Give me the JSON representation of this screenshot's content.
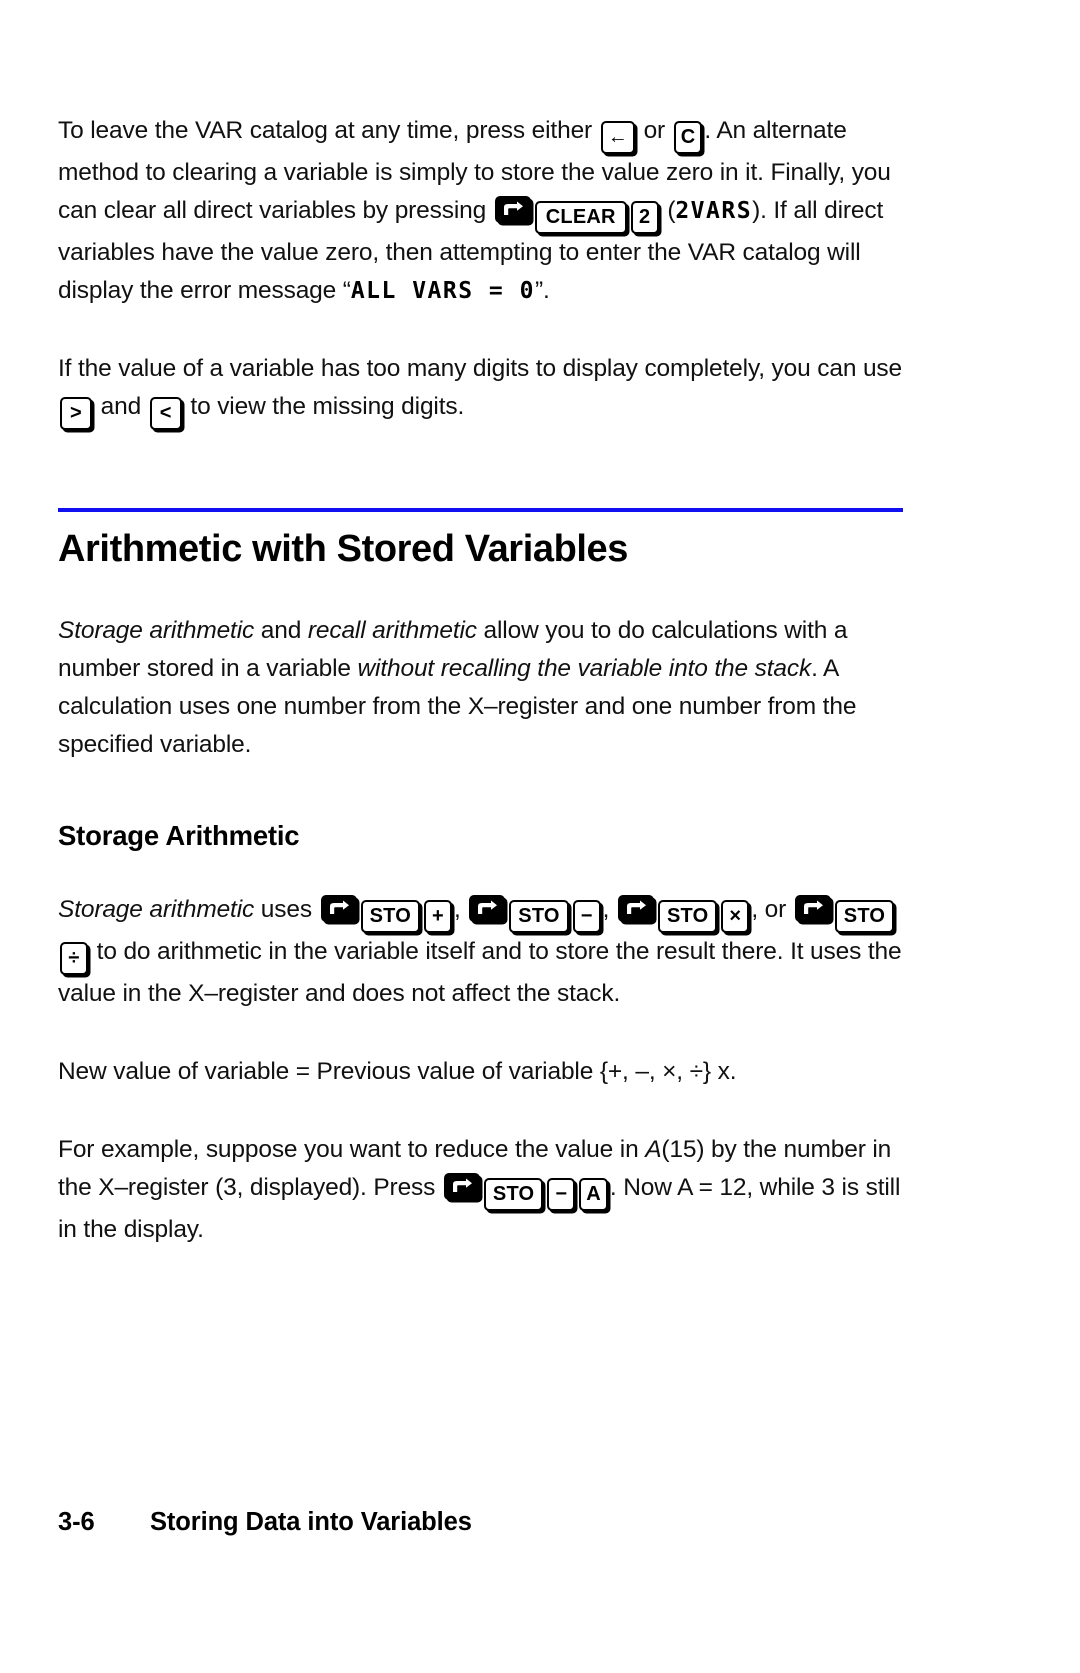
{
  "document": {
    "type": "calculator-user-manual-page",
    "accent_rule_color": "#1010f0",
    "text_color": "#000000",
    "background_color": "#ffffff"
  },
  "paragraph1": {
    "t1": "To leave the VAR catalog at any time, press either ",
    "key_backspace": "←",
    "t2": " or ",
    "key_c": "C",
    "t3": ".  An alternate method to clearing a variable is simply to store the value zero in it.  Finally, you can clear all direct variables by pressing ",
    "key_shift": "right-shift",
    "key_clear": "CLEAR",
    "key_2": "2",
    "t4": "  (",
    "lcd_2vars": "2VARS",
    "t5": ").  If all direct variables have the value zero, then attempting to enter the VAR catalog will display the error message “",
    "lcd_all_vars": "ALL VARS = 0",
    "t6": "”."
  },
  "paragraph2": {
    "t1": "If the value of a variable has too many digits to display completely, you can use ",
    "key_right": ">",
    "t2": " and ",
    "key_left": "<",
    "t3": " to view the missing digits."
  },
  "section": {
    "title": "Arithmetic with Stored Variables"
  },
  "paragraph3": {
    "i1": "Storage arithmetic",
    "t1": " and ",
    "i2": "recall arithmetic",
    "t2": " allow you to do calculations with a number stored in a variable ",
    "i3": "without recalling the variable into the stack",
    "t3": ". A calculation uses one number from the X–register and one number from the specified variable."
  },
  "subsection": {
    "title": "Storage Arithmetic"
  },
  "paragraph4": {
    "i1": "Storage arithmetic",
    "t1": " uses ",
    "key_shift": "right-shift",
    "key_sto": "STO",
    "key_plus": "+",
    "t2": ", ",
    "key_minus": "−",
    "t3": ", ",
    "key_times": "×",
    "t4": ", or ",
    "key_divide": "÷",
    "t5": " to do arithmetic in the variable itself and to store the result there. It uses the value in the X–register and does not affect the stack."
  },
  "paragraph5": {
    "text": "New value of variable = Previous value of variable {+, –, ×, ÷} x."
  },
  "paragraph6": {
    "t1": "For example, suppose you want to reduce the value in ",
    "i1": "A",
    "t2": "(15) by the number in the X–register (3, displayed). Press ",
    "key_shift": "right-shift",
    "key_sto": "STO",
    "key_minus": "−",
    "key_a": "A",
    "t3": ". Now A = 12, while 3 is still in the display."
  },
  "footer": {
    "page_number": "3-6",
    "chapter_title": "Storing Data into Variables"
  }
}
